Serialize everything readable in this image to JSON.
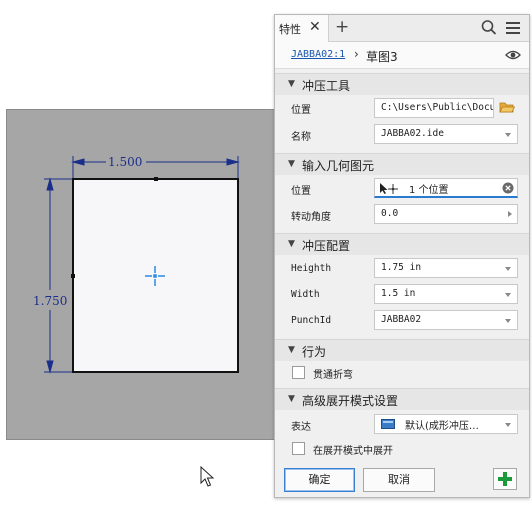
{
  "canvas": {
    "dimension_width": "1.500",
    "dimension_height": "1.750"
  },
  "panel": {
    "tab": {
      "label": "特性"
    },
    "breadcrumb": {
      "link": "JABBA02:1",
      "separator": "›",
      "current": "草图3"
    },
    "sections": {
      "punch_tool": {
        "title": "冲压工具",
        "location_label": "位置",
        "location_value": "C:\\Users\\Public\\Docum",
        "name_label": "名称",
        "name_value": "JABBA02.ide"
      },
      "input_geometry": {
        "title": "输入几何图元",
        "position_label": "位置",
        "position_value": "1 个位置",
        "rotation_label": "转动角度",
        "rotation_value": "0.0"
      },
      "punch_config": {
        "title": "冲压配置",
        "height_label": "Heighth",
        "height_value": "1.75 in",
        "width_label": "Width",
        "width_value": "1.5 in",
        "punchid_label": "PunchId",
        "punchid_value": "JABBA02"
      },
      "behavior": {
        "title": "行为",
        "through_bend_label": "贯通折弯",
        "through_bend_checked": false
      },
      "advanced_flat": {
        "title": "高级展开模式设置",
        "representation_label": "表达",
        "representation_value": "默认(成形冲压…",
        "center_flat_label": "在展开模式中展开",
        "center_flat_checked": false
      }
    },
    "buttons": {
      "ok": "确定",
      "cancel": "取消"
    }
  },
  "icons": {
    "tab_close": "close-icon",
    "tab_add": "plus-icon",
    "search": "search-icon",
    "menu": "hamburger-menu-icon",
    "visibility": "eye-icon",
    "folder": "folder-icon",
    "select": "select-arrow-icon",
    "clear": "clear-icon",
    "representation": "sheet-icon",
    "add": "green-plus-icon",
    "cursor": "mouse-cursor-icon"
  },
  "colors": {
    "dimension": "#1b2f8a",
    "center_mark": "#2a8adf",
    "add_button": "#1a9a3a",
    "folder": "#e8a93a"
  }
}
